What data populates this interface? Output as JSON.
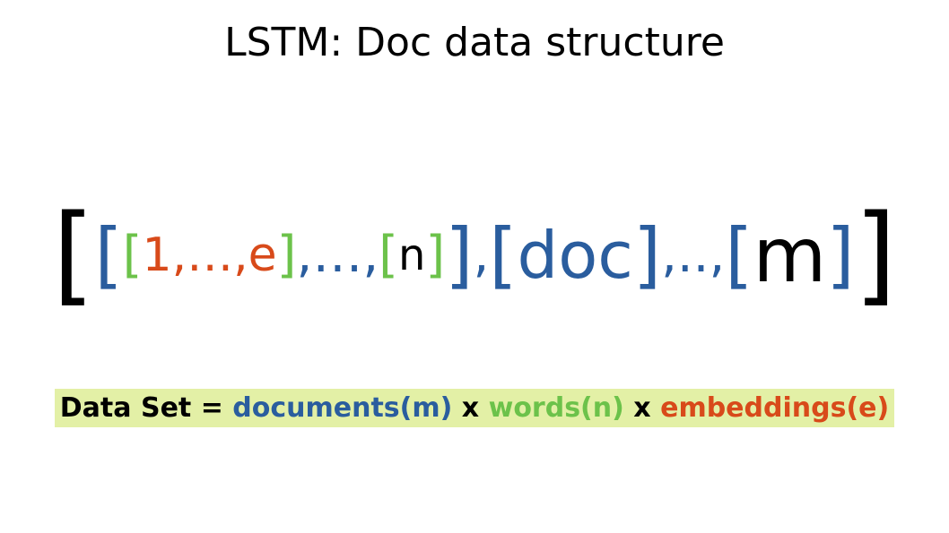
{
  "title": "LSTM: Doc data structure",
  "expr": {
    "outer_open": "[",
    "lvl2a_open": "[",
    "lvl3_open": "[",
    "lvl3_inner": "1,…,e",
    "lvl3_close": "]",
    "lvl2a_mid": ",…,",
    "lvl3b_open": "[",
    "lvl2a_n": "n",
    "lvl3b_close": "]",
    "lvl2a_close": "]",
    "sep1": ",",
    "lvl2b_open": "[",
    "doc": "doc",
    "lvl2b_close": "]",
    "sep2": ",..,",
    "lvl2c_open": "[",
    "m": "m",
    "lvl2c_close": "]",
    "outer_close": "]"
  },
  "formula": {
    "lhs": "Data Set = ",
    "docs": "documents(m)",
    "x1": " x ",
    "words": "words(n)",
    "x2": " x ",
    "emb": "embeddings(e)"
  }
}
